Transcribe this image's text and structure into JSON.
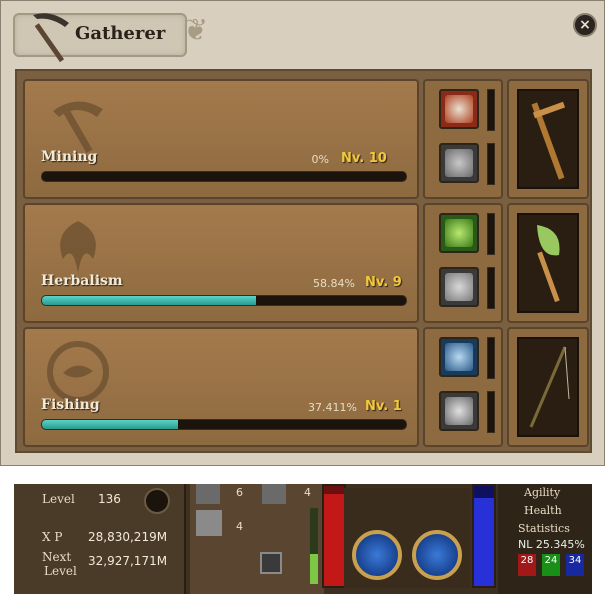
{
  "window": {
    "title": "Gatherer",
    "close_label": "×"
  },
  "skills": [
    {
      "name": "Mining",
      "percent": "0%",
      "progress": 0,
      "level": "Nv. 10",
      "icon": "pickaxe-icon"
    },
    {
      "name": "Herbalism",
      "percent": "58.84%",
      "progress": 0.5884,
      "level": "Nv. 9",
      "icon": "herb-icon"
    },
    {
      "name": "Fishing",
      "percent": "37.411%",
      "progress": 0.37411,
      "level": "Nv. 1",
      "icon": "fish-icon"
    }
  ],
  "hud": {
    "level_label": "Level",
    "level_value": "136",
    "xp_label": "X P",
    "xp_value": "28,830,219M",
    "next_label": "Next",
    "next_label2": "Level",
    "next_value": "32,927,171M",
    "count_a": "6",
    "count_b": "4",
    "count_c": "4",
    "menu_agility": "Agility",
    "menu_health": "Health",
    "menu_statistics": "Statistics",
    "nl_label": "NL 25.345%",
    "potions": [
      "28",
      "24",
      "34"
    ]
  },
  "colors": {
    "progress": "#2a9a90",
    "level": "#f2c93a"
  }
}
